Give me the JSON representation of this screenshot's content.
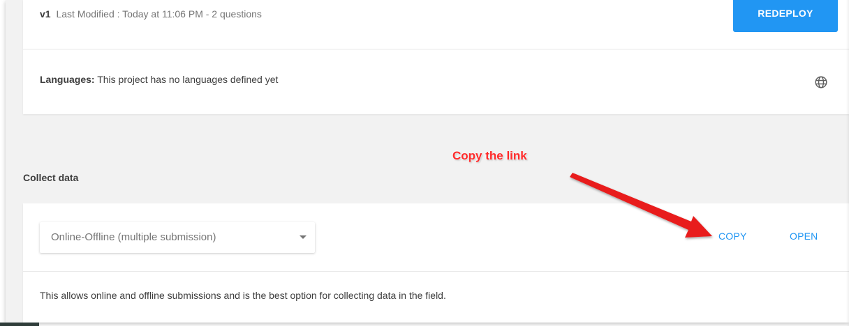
{
  "version": {
    "tag": "v1",
    "meta": "Last Modified : Today at 11:06 PM - 2 questions",
    "redeploy_label": "REDEPLOY"
  },
  "languages": {
    "label": "Languages:",
    "text": "This project has no languages defined yet",
    "icon": "globe-icon"
  },
  "collect": {
    "section_title": "Collect data",
    "select_value": "Online-Offline (multiple submission)",
    "copy_label": "COPY",
    "open_label": "OPEN",
    "description": "This allows online and offline submissions and is the best option for collecting data in the field."
  },
  "annotation": {
    "text": "Copy the link",
    "color": "#ff2b2b"
  },
  "colors": {
    "accent": "#2196f3",
    "background": "#f2f2f2",
    "card": "#ffffff"
  }
}
